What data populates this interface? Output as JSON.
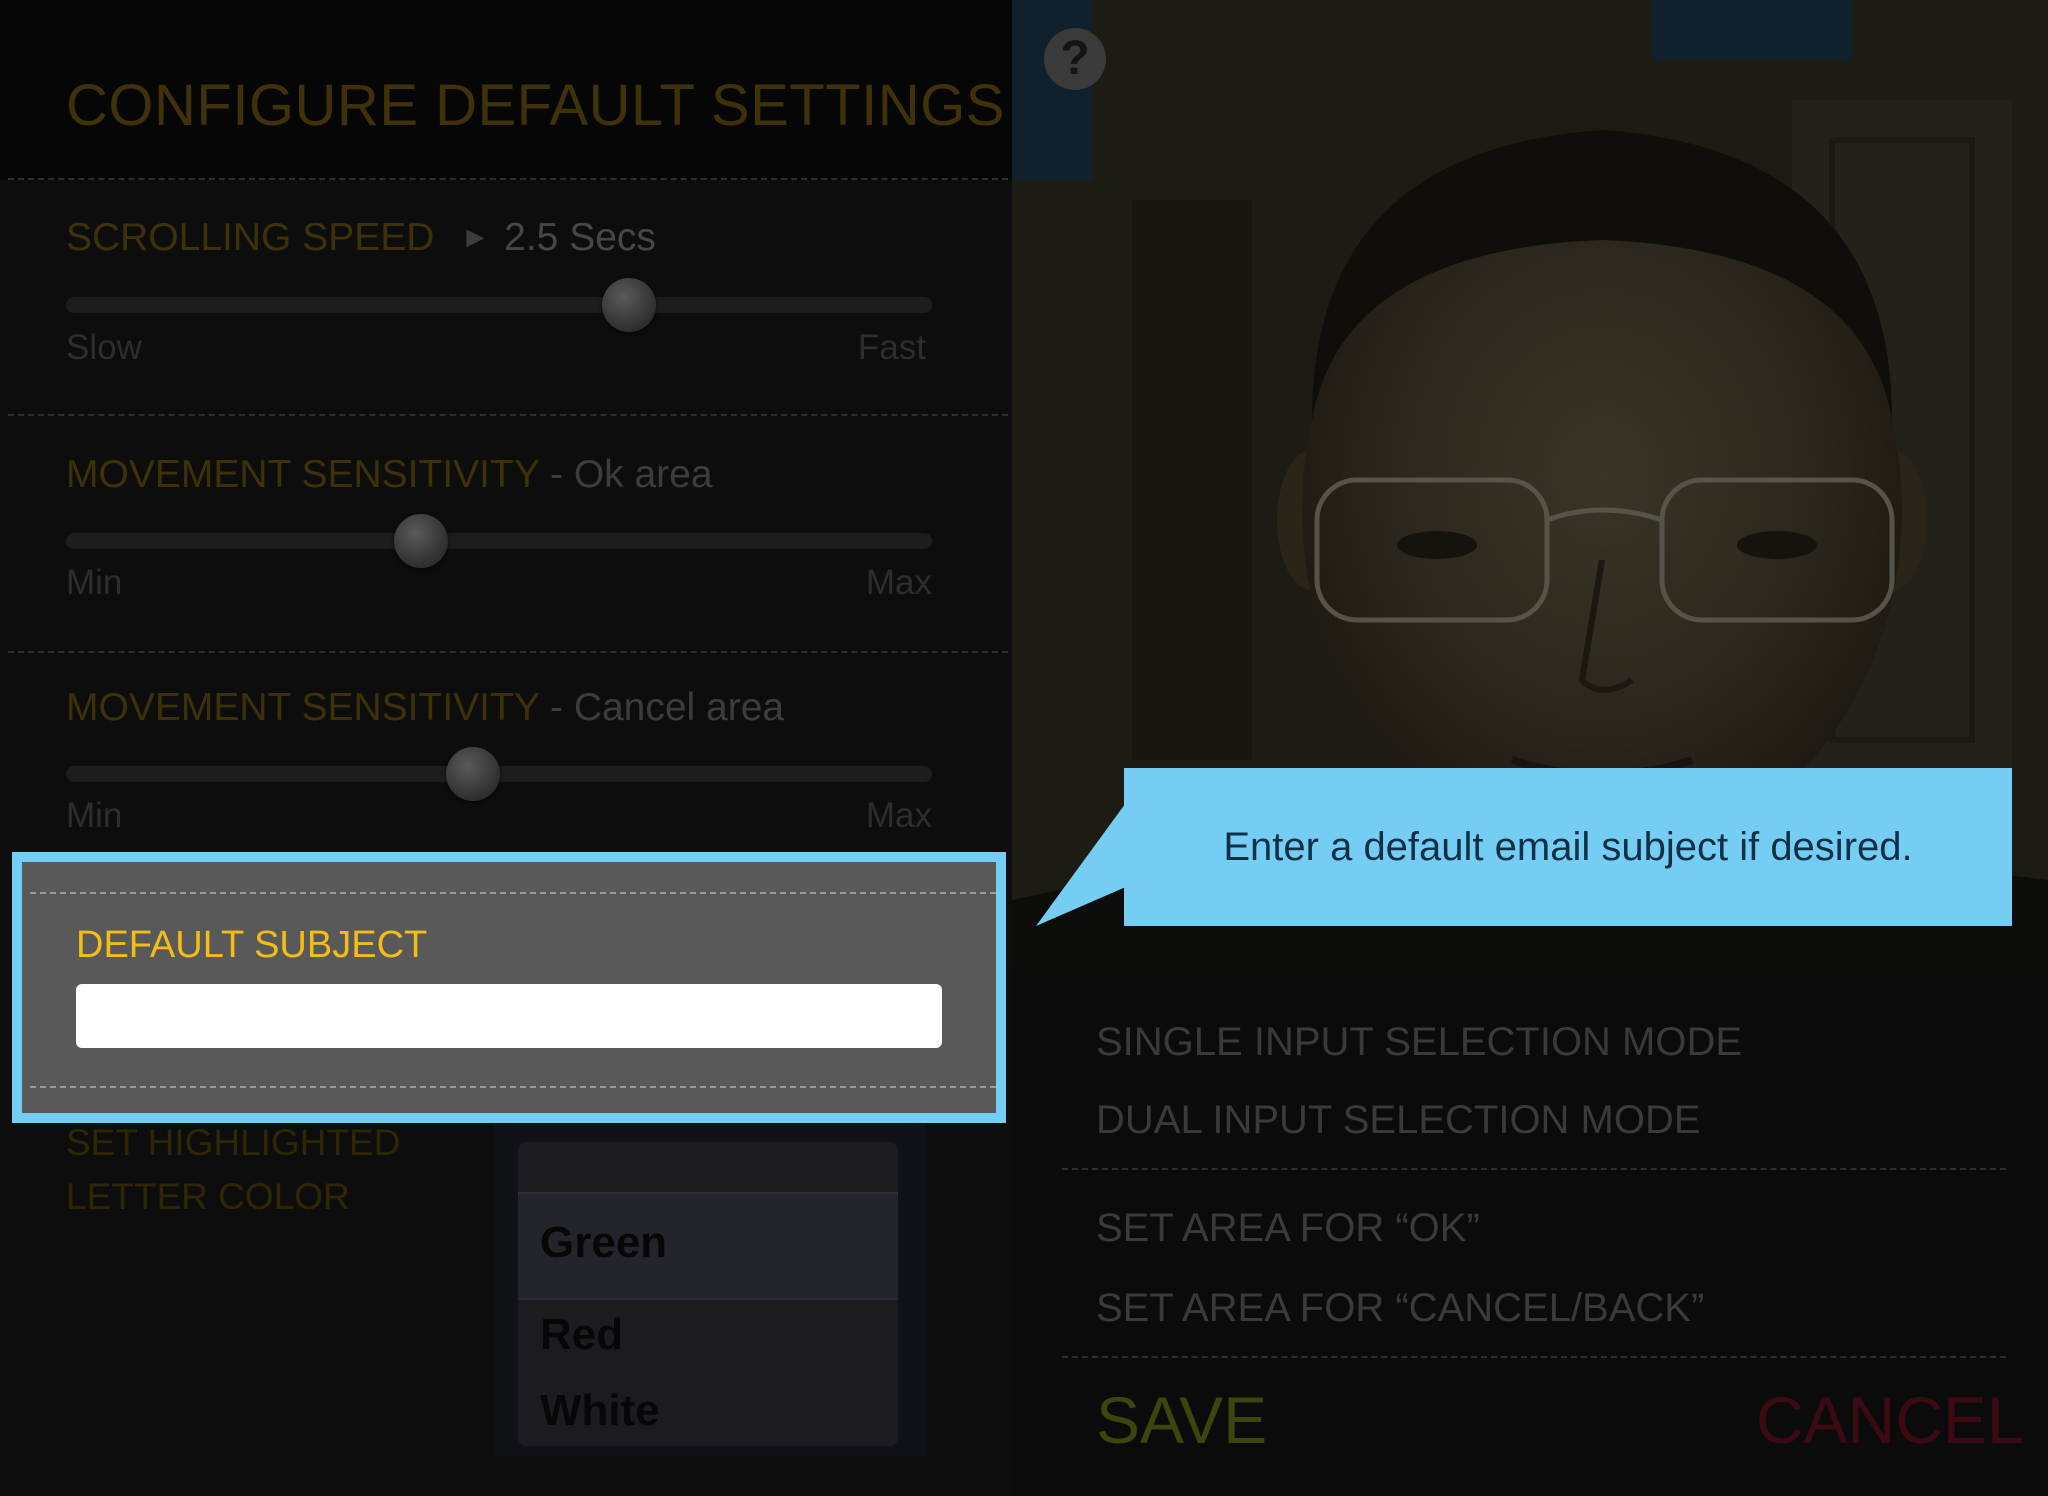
{
  "header": {
    "title": "CONFIGURE DEFAULT SETTINGS"
  },
  "scrolling_speed": {
    "label": "SCROLLING SPEED",
    "arrow": "►",
    "value": "2.5 Secs",
    "min_label": "Slow",
    "max_label": "Fast",
    "level": 0.65
  },
  "sensitivity_ok": {
    "label": "MOVEMENT SENSITIVITY",
    "suffix": " - Ok area",
    "min_label": "Min",
    "max_label": "Max",
    "level": 0.41
  },
  "sensitivity_cancel": {
    "label": "MOVEMENT SENSITIVITY",
    "suffix": " - Cancel area",
    "min_label": "Min",
    "max_label": "Max",
    "level": 0.47
  },
  "default_subject": {
    "label": "DEFAULT SUBJECT",
    "value": ""
  },
  "letter_color": {
    "label_line1": "SET HIGHLIGHTED",
    "label_line2": "LETTER COLOR",
    "options": [
      "Green",
      "Red",
      "White"
    ],
    "selected": "Green"
  },
  "help": {
    "glyph": "?"
  },
  "callout": {
    "text": "Enter a default email subject if desired."
  },
  "modes": {
    "single": "SINGLE INPUT SELECTION MODE",
    "dual": "DUAL INPUT SELECTION MODE"
  },
  "areas": {
    "ok": "SET AREA FOR “OK”",
    "cancel": "SET AREA FOR “CANCEL/BACK”"
  },
  "actions": {
    "save": "SAVE",
    "cancel": "CANCEL"
  },
  "colors": {
    "accent_yellow": "#f4bd16",
    "callout_blue": "#75cdf3",
    "save_green": "#3d450c",
    "cancel_red": "#3c0a12"
  }
}
